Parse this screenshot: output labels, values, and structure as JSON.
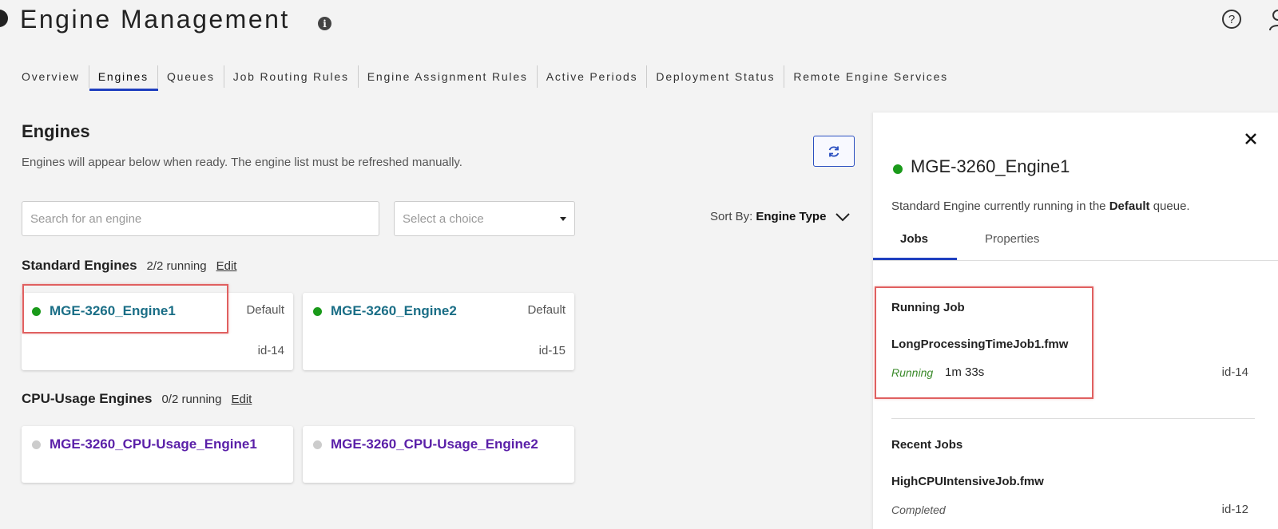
{
  "header": {
    "title": "Engine Management",
    "info_icon": "info-icon",
    "help_icon": "help-icon",
    "user_icon": "user-icon"
  },
  "tabs": [
    {
      "label": "Overview",
      "active": false
    },
    {
      "label": "Engines",
      "active": true
    },
    {
      "label": "Queues",
      "active": false
    },
    {
      "label": "Job Routing Rules",
      "active": false
    },
    {
      "label": "Engine Assignment Rules",
      "active": false
    },
    {
      "label": "Active Periods",
      "active": false
    },
    {
      "label": "Deployment Status",
      "active": false
    },
    {
      "label": "Remote Engine Services",
      "active": false
    }
  ],
  "main": {
    "title": "Engines",
    "description": "Engines will appear below when ready. The engine list must be refreshed manually.",
    "search_placeholder": "Search for an engine",
    "select_placeholder": "Select a choice",
    "sort_label": "Sort By:",
    "sort_value": "Engine Type"
  },
  "groups": [
    {
      "name": "Standard Engines",
      "count": "2/2 running",
      "edit": "Edit",
      "engines": [
        {
          "name": "MGE-3260_Engine1",
          "queue": "Default",
          "id": "id-14",
          "status_color": "#1a9a1a",
          "name_color": "#1a6e86"
        },
        {
          "name": "MGE-3260_Engine2",
          "queue": "Default",
          "id": "id-15",
          "status_color": "#1a9a1a",
          "name_color": "#1a6e86"
        }
      ]
    },
    {
      "name": "CPU-Usage Engines",
      "count": "0/2 running",
      "edit": "Edit",
      "engines": [
        {
          "name": "MGE-3260_CPU-Usage_Engine1",
          "status_color": "#cccccc",
          "name_color": "#5a1fa8"
        },
        {
          "name": "MGE-3260_CPU-Usage_Engine2",
          "status_color": "#cccccc",
          "name_color": "#5a1fa8"
        }
      ]
    }
  ],
  "panel": {
    "title": "MGE-3260_Engine1",
    "status_color": "#1a9a1a",
    "desc_prefix": "Standard Engine currently running in the",
    "desc_queue": "Default",
    "desc_suffix": "queue.",
    "tabs": [
      "Jobs",
      "Properties"
    ],
    "running_heading": "Running Job",
    "running_job": {
      "file": "LongProcessingTimeJob1.fmw",
      "status": "Running",
      "status_color": "#3a8a2a",
      "duration": "1m 33s",
      "id": "id-14"
    },
    "recent_heading": "Recent Jobs",
    "recent_job": {
      "file": "HighCPUIntensiveJob.fmw",
      "status": "Completed",
      "status_color": "#555555",
      "id": "id-12"
    }
  }
}
